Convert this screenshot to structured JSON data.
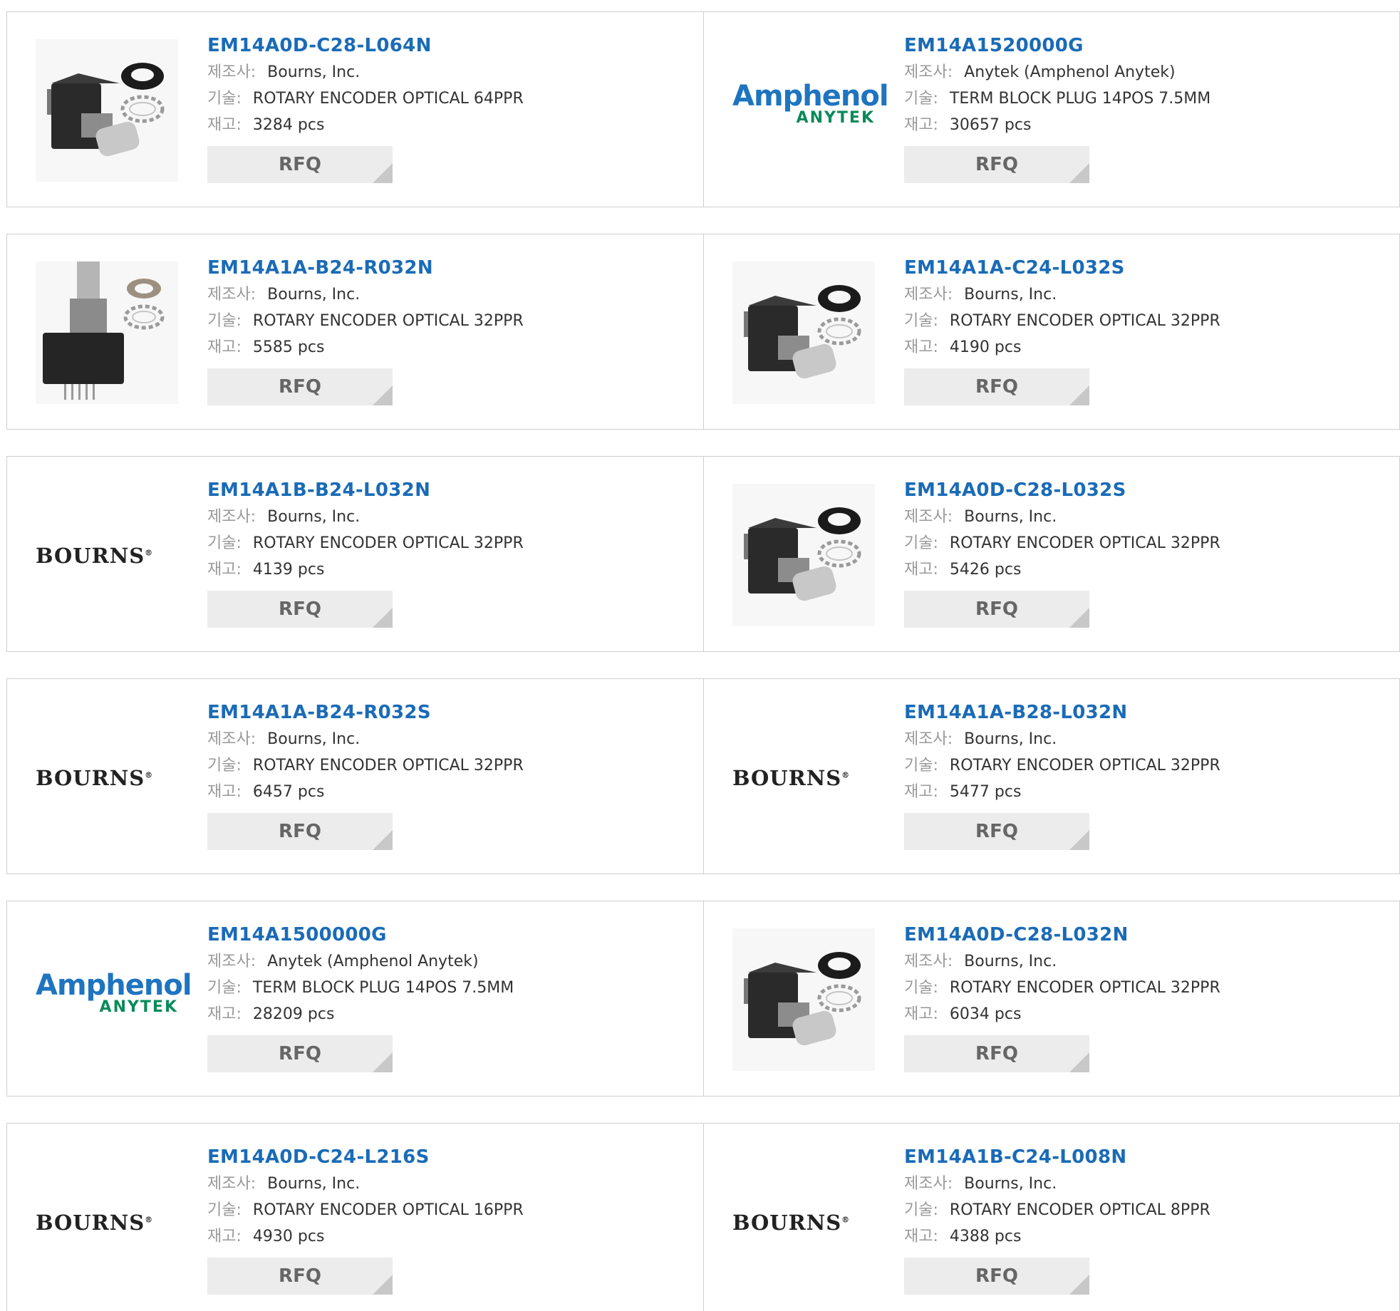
{
  "labels": {
    "manufacturer": "제조사:",
    "description": "기술:",
    "stock": "재고:",
    "rfq": "RFQ"
  },
  "products": [
    {
      "part": "EM14A0D-C28-L064N",
      "manufacturer": "Bourns, Inc.",
      "description": "ROTARY ENCODER OPTICAL 64PPR",
      "stock": "3284 pcs",
      "image": "encoder-photo"
    },
    {
      "part": "EM14A1520000G",
      "manufacturer": "Anytek (Amphenol Anytek)",
      "description": "TERM BLOCK PLUG 14POS 7.5MM",
      "stock": "30657 pcs",
      "image": "amphenol-logo",
      "logo_text": {
        "line1": "Amphenol",
        "line2": "ANYTEK"
      }
    },
    {
      "part": "EM14A1A-B24-R032N",
      "manufacturer": "Bourns, Inc.",
      "description": "ROTARY ENCODER OPTICAL 32PPR",
      "stock": "5585 pcs",
      "image": "encoder-vertical-photo"
    },
    {
      "part": "EM14A1A-C24-L032S",
      "manufacturer": "Bourns, Inc.",
      "description": "ROTARY ENCODER OPTICAL 32PPR",
      "stock": "4190 pcs",
      "image": "encoder-photo"
    },
    {
      "part": "EM14A1B-B24-L032N",
      "manufacturer": "Bourns, Inc.",
      "description": "ROTARY ENCODER OPTICAL 32PPR",
      "stock": "4139 pcs",
      "image": "bourns-logo",
      "logo_text": {
        "line1": "BOURNS",
        "line2": "®"
      }
    },
    {
      "part": "EM14A0D-C28-L032S",
      "manufacturer": "Bourns, Inc.",
      "description": "ROTARY ENCODER OPTICAL 32PPR",
      "stock": "5426 pcs",
      "image": "encoder-photo"
    },
    {
      "part": "EM14A1A-B24-R032S",
      "manufacturer": "Bourns, Inc.",
      "description": "ROTARY ENCODER OPTICAL 32PPR",
      "stock": "6457 pcs",
      "image": "bourns-logo",
      "logo_text": {
        "line1": "BOURNS",
        "line2": "®"
      }
    },
    {
      "part": "EM14A1A-B28-L032N",
      "manufacturer": "Bourns, Inc.",
      "description": "ROTARY ENCODER OPTICAL 32PPR",
      "stock": "5477 pcs",
      "image": "bourns-logo",
      "logo_text": {
        "line1": "BOURNS",
        "line2": "®"
      }
    },
    {
      "part": "EM14A1500000G",
      "manufacturer": "Anytek (Amphenol Anytek)",
      "description": "TERM BLOCK PLUG 14POS 7.5MM",
      "stock": "28209 pcs",
      "image": "amphenol-logo",
      "logo_text": {
        "line1": "Amphenol",
        "line2": "ANYTEK"
      }
    },
    {
      "part": "EM14A0D-C28-L032N",
      "manufacturer": "Bourns, Inc.",
      "description": "ROTARY ENCODER OPTICAL 32PPR",
      "stock": "6034 pcs",
      "image": "encoder-photo"
    },
    {
      "part": "EM14A0D-C24-L216S",
      "manufacturer": "Bourns, Inc.",
      "description": "ROTARY ENCODER OPTICAL 16PPR",
      "stock": "4930 pcs",
      "image": "bourns-logo",
      "logo_text": {
        "line1": "BOURNS",
        "line2": "®"
      }
    },
    {
      "part": "EM14A1B-C24-L008N",
      "manufacturer": "Bourns, Inc.",
      "description": "ROTARY ENCODER OPTICAL 8PPR",
      "stock": "4388 pcs",
      "image": "bourns-logo",
      "logo_text": {
        "line1": "BOURNS",
        "line2": "®"
      }
    }
  ]
}
